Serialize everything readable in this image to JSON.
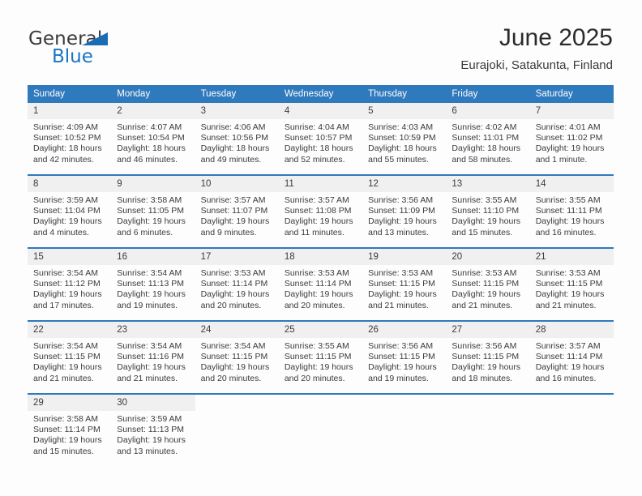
{
  "brand": {
    "word1": "General",
    "word2": "Blue",
    "triangle_color": "#1b6cb5",
    "blue_color": "#1b74c4"
  },
  "header": {
    "title": "June 2025",
    "subtitle": "Eurajoki, Satakunta, Finland"
  },
  "theme": {
    "header_bg": "#2f79bd",
    "daynum_bg": "#f0f0f0",
    "row_divider": "#2f79bd",
    "text": "#3b3b3b",
    "page_bg": "#fdfdfd"
  },
  "weekdays": [
    "Sunday",
    "Monday",
    "Tuesday",
    "Wednesday",
    "Thursday",
    "Friday",
    "Saturday"
  ],
  "weeks": [
    [
      {
        "day": "1",
        "sunrise": "Sunrise: 4:09 AM",
        "sunset": "Sunset: 10:52 PM",
        "daylight_line1": "Daylight: 18 hours",
        "daylight_line2": "and 42 minutes."
      },
      {
        "day": "2",
        "sunrise": "Sunrise: 4:07 AM",
        "sunset": "Sunset: 10:54 PM",
        "daylight_line1": "Daylight: 18 hours",
        "daylight_line2": "and 46 minutes."
      },
      {
        "day": "3",
        "sunrise": "Sunrise: 4:06 AM",
        "sunset": "Sunset: 10:56 PM",
        "daylight_line1": "Daylight: 18 hours",
        "daylight_line2": "and 49 minutes."
      },
      {
        "day": "4",
        "sunrise": "Sunrise: 4:04 AM",
        "sunset": "Sunset: 10:57 PM",
        "daylight_line1": "Daylight: 18 hours",
        "daylight_line2": "and 52 minutes."
      },
      {
        "day": "5",
        "sunrise": "Sunrise: 4:03 AM",
        "sunset": "Sunset: 10:59 PM",
        "daylight_line1": "Daylight: 18 hours",
        "daylight_line2": "and 55 minutes."
      },
      {
        "day": "6",
        "sunrise": "Sunrise: 4:02 AM",
        "sunset": "Sunset: 11:01 PM",
        "daylight_line1": "Daylight: 18 hours",
        "daylight_line2": "and 58 minutes."
      },
      {
        "day": "7",
        "sunrise": "Sunrise: 4:01 AM",
        "sunset": "Sunset: 11:02 PM",
        "daylight_line1": "Daylight: 19 hours",
        "daylight_line2": "and 1 minute."
      }
    ],
    [
      {
        "day": "8",
        "sunrise": "Sunrise: 3:59 AM",
        "sunset": "Sunset: 11:04 PM",
        "daylight_line1": "Daylight: 19 hours",
        "daylight_line2": "and 4 minutes."
      },
      {
        "day": "9",
        "sunrise": "Sunrise: 3:58 AM",
        "sunset": "Sunset: 11:05 PM",
        "daylight_line1": "Daylight: 19 hours",
        "daylight_line2": "and 6 minutes."
      },
      {
        "day": "10",
        "sunrise": "Sunrise: 3:57 AM",
        "sunset": "Sunset: 11:07 PM",
        "daylight_line1": "Daylight: 19 hours",
        "daylight_line2": "and 9 minutes."
      },
      {
        "day": "11",
        "sunrise": "Sunrise: 3:57 AM",
        "sunset": "Sunset: 11:08 PM",
        "daylight_line1": "Daylight: 19 hours",
        "daylight_line2": "and 11 minutes."
      },
      {
        "day": "12",
        "sunrise": "Sunrise: 3:56 AM",
        "sunset": "Sunset: 11:09 PM",
        "daylight_line1": "Daylight: 19 hours",
        "daylight_line2": "and 13 minutes."
      },
      {
        "day": "13",
        "sunrise": "Sunrise: 3:55 AM",
        "sunset": "Sunset: 11:10 PM",
        "daylight_line1": "Daylight: 19 hours",
        "daylight_line2": "and 15 minutes."
      },
      {
        "day": "14",
        "sunrise": "Sunrise: 3:55 AM",
        "sunset": "Sunset: 11:11 PM",
        "daylight_line1": "Daylight: 19 hours",
        "daylight_line2": "and 16 minutes."
      }
    ],
    [
      {
        "day": "15",
        "sunrise": "Sunrise: 3:54 AM",
        "sunset": "Sunset: 11:12 PM",
        "daylight_line1": "Daylight: 19 hours",
        "daylight_line2": "and 17 minutes."
      },
      {
        "day": "16",
        "sunrise": "Sunrise: 3:54 AM",
        "sunset": "Sunset: 11:13 PM",
        "daylight_line1": "Daylight: 19 hours",
        "daylight_line2": "and 19 minutes."
      },
      {
        "day": "17",
        "sunrise": "Sunrise: 3:53 AM",
        "sunset": "Sunset: 11:14 PM",
        "daylight_line1": "Daylight: 19 hours",
        "daylight_line2": "and 20 minutes."
      },
      {
        "day": "18",
        "sunrise": "Sunrise: 3:53 AM",
        "sunset": "Sunset: 11:14 PM",
        "daylight_line1": "Daylight: 19 hours",
        "daylight_line2": "and 20 minutes."
      },
      {
        "day": "19",
        "sunrise": "Sunrise: 3:53 AM",
        "sunset": "Sunset: 11:15 PM",
        "daylight_line1": "Daylight: 19 hours",
        "daylight_line2": "and 21 minutes."
      },
      {
        "day": "20",
        "sunrise": "Sunrise: 3:53 AM",
        "sunset": "Sunset: 11:15 PM",
        "daylight_line1": "Daylight: 19 hours",
        "daylight_line2": "and 21 minutes."
      },
      {
        "day": "21",
        "sunrise": "Sunrise: 3:53 AM",
        "sunset": "Sunset: 11:15 PM",
        "daylight_line1": "Daylight: 19 hours",
        "daylight_line2": "and 21 minutes."
      }
    ],
    [
      {
        "day": "22",
        "sunrise": "Sunrise: 3:54 AM",
        "sunset": "Sunset: 11:15 PM",
        "daylight_line1": "Daylight: 19 hours",
        "daylight_line2": "and 21 minutes."
      },
      {
        "day": "23",
        "sunrise": "Sunrise: 3:54 AM",
        "sunset": "Sunset: 11:16 PM",
        "daylight_line1": "Daylight: 19 hours",
        "daylight_line2": "and 21 minutes."
      },
      {
        "day": "24",
        "sunrise": "Sunrise: 3:54 AM",
        "sunset": "Sunset: 11:15 PM",
        "daylight_line1": "Daylight: 19 hours",
        "daylight_line2": "and 20 minutes."
      },
      {
        "day": "25",
        "sunrise": "Sunrise: 3:55 AM",
        "sunset": "Sunset: 11:15 PM",
        "daylight_line1": "Daylight: 19 hours",
        "daylight_line2": "and 20 minutes."
      },
      {
        "day": "26",
        "sunrise": "Sunrise: 3:56 AM",
        "sunset": "Sunset: 11:15 PM",
        "daylight_line1": "Daylight: 19 hours",
        "daylight_line2": "and 19 minutes."
      },
      {
        "day": "27",
        "sunrise": "Sunrise: 3:56 AM",
        "sunset": "Sunset: 11:15 PM",
        "daylight_line1": "Daylight: 19 hours",
        "daylight_line2": "and 18 minutes."
      },
      {
        "day": "28",
        "sunrise": "Sunrise: 3:57 AM",
        "sunset": "Sunset: 11:14 PM",
        "daylight_line1": "Daylight: 19 hours",
        "daylight_line2": "and 16 minutes."
      }
    ],
    [
      {
        "day": "29",
        "sunrise": "Sunrise: 3:58 AM",
        "sunset": "Sunset: 11:14 PM",
        "daylight_line1": "Daylight: 19 hours",
        "daylight_line2": "and 15 minutes."
      },
      {
        "day": "30",
        "sunrise": "Sunrise: 3:59 AM",
        "sunset": "Sunset: 11:13 PM",
        "daylight_line1": "Daylight: 19 hours",
        "daylight_line2": "and 13 minutes."
      },
      {
        "day": "",
        "sunrise": "",
        "sunset": "",
        "daylight_line1": "",
        "daylight_line2": ""
      },
      {
        "day": "",
        "sunrise": "",
        "sunset": "",
        "daylight_line1": "",
        "daylight_line2": ""
      },
      {
        "day": "",
        "sunrise": "",
        "sunset": "",
        "daylight_line1": "",
        "daylight_line2": ""
      },
      {
        "day": "",
        "sunrise": "",
        "sunset": "",
        "daylight_line1": "",
        "daylight_line2": ""
      },
      {
        "day": "",
        "sunrise": "",
        "sunset": "",
        "daylight_line1": "",
        "daylight_line2": ""
      }
    ]
  ]
}
